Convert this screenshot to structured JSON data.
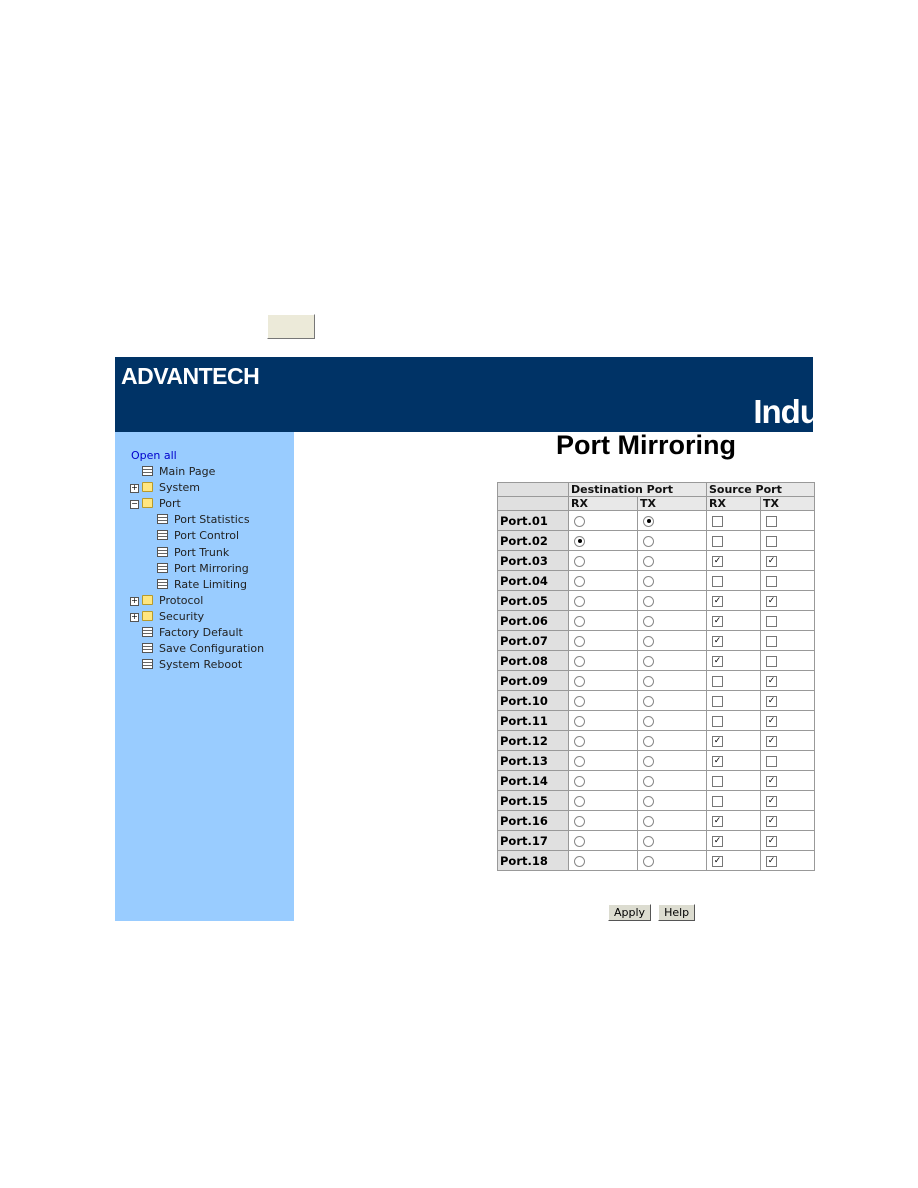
{
  "brand": {
    "logo": "ADVANTECH",
    "banner_text": "Indu",
    "banner_color": "#003366",
    "sidebar_color": "#99ccff"
  },
  "sidebar": {
    "open_all": "Open all",
    "items": [
      {
        "label": "Main Page",
        "type": "page",
        "indent": 0
      },
      {
        "label": "System",
        "type": "folder",
        "indent": 0,
        "expander": "+"
      },
      {
        "label": "Port",
        "type": "folder-open",
        "indent": 0,
        "expander": "−"
      },
      {
        "label": "Port Statistics",
        "type": "page",
        "indent": 1
      },
      {
        "label": "Port Control",
        "type": "page",
        "indent": 1
      },
      {
        "label": "Port Trunk",
        "type": "page",
        "indent": 1
      },
      {
        "label": "Port Mirroring",
        "type": "page",
        "indent": 1
      },
      {
        "label": "Rate Limiting",
        "type": "page",
        "indent": 1
      },
      {
        "label": "Protocol",
        "type": "folder",
        "indent": 0,
        "expander": "+"
      },
      {
        "label": "Security",
        "type": "folder",
        "indent": 0,
        "expander": "+"
      },
      {
        "label": "Factory Default",
        "type": "page",
        "indent": 0
      },
      {
        "label": "Save Configuration",
        "type": "page",
        "indent": 0
      },
      {
        "label": "System Reboot",
        "type": "page",
        "indent": 0
      }
    ]
  },
  "main": {
    "title": "Port Mirroring",
    "headers": {
      "destination": "Destination Port",
      "source": "Source Port",
      "rx": "RX",
      "tx": "TX"
    },
    "rows": [
      {
        "port": "Port.01",
        "dest_rx": false,
        "dest_tx": true,
        "src_rx": false,
        "src_tx": false
      },
      {
        "port": "Port.02",
        "dest_rx": true,
        "dest_tx": false,
        "src_rx": false,
        "src_tx": false
      },
      {
        "port": "Port.03",
        "dest_rx": false,
        "dest_tx": false,
        "src_rx": true,
        "src_tx": true
      },
      {
        "port": "Port.04",
        "dest_rx": false,
        "dest_tx": false,
        "src_rx": false,
        "src_tx": false
      },
      {
        "port": "Port.05",
        "dest_rx": false,
        "dest_tx": false,
        "src_rx": true,
        "src_tx": true
      },
      {
        "port": "Port.06",
        "dest_rx": false,
        "dest_tx": false,
        "src_rx": true,
        "src_tx": false
      },
      {
        "port": "Port.07",
        "dest_rx": false,
        "dest_tx": false,
        "src_rx": true,
        "src_tx": false
      },
      {
        "port": "Port.08",
        "dest_rx": false,
        "dest_tx": false,
        "src_rx": true,
        "src_tx": false
      },
      {
        "port": "Port.09",
        "dest_rx": false,
        "dest_tx": false,
        "src_rx": false,
        "src_tx": true
      },
      {
        "port": "Port.10",
        "dest_rx": false,
        "dest_tx": false,
        "src_rx": false,
        "src_tx": true
      },
      {
        "port": "Port.11",
        "dest_rx": false,
        "dest_tx": false,
        "src_rx": false,
        "src_tx": true
      },
      {
        "port": "Port.12",
        "dest_rx": false,
        "dest_tx": false,
        "src_rx": true,
        "src_tx": true
      },
      {
        "port": "Port.13",
        "dest_rx": false,
        "dest_tx": false,
        "src_rx": true,
        "src_tx": false
      },
      {
        "port": "Port.14",
        "dest_rx": false,
        "dest_tx": false,
        "src_rx": false,
        "src_tx": true
      },
      {
        "port": "Port.15",
        "dest_rx": false,
        "dest_tx": false,
        "src_rx": false,
        "src_tx": true
      },
      {
        "port": "Port.16",
        "dest_rx": false,
        "dest_tx": false,
        "src_rx": true,
        "src_tx": true
      },
      {
        "port": "Port.17",
        "dest_rx": false,
        "dest_tx": false,
        "src_rx": true,
        "src_tx": true
      },
      {
        "port": "Port.18",
        "dest_rx": false,
        "dest_tx": false,
        "src_rx": true,
        "src_tx": true
      }
    ],
    "apply_label": "Apply",
    "help_label": "Help"
  }
}
